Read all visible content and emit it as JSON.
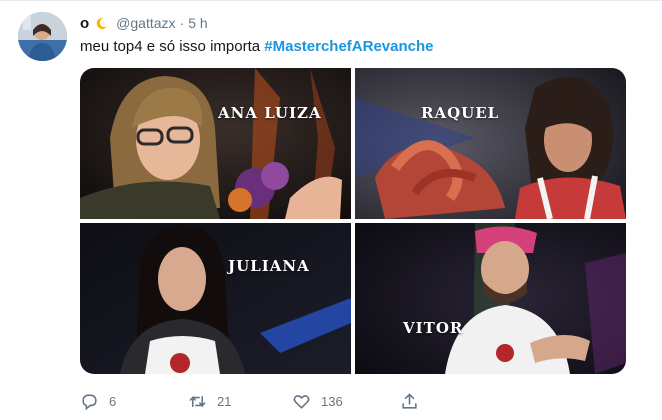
{
  "tweet": {
    "name": "o",
    "handle": "@gattazx",
    "separator": "·",
    "time": "5 h",
    "text_plain": "meu top4 e só isso importa ",
    "hashtag": "#MasterchefARevanche",
    "colors": {
      "hashtag": "#1b95e0",
      "secondary_text": "#657786",
      "primary_text": "#14171a"
    }
  },
  "media": {
    "panels": [
      {
        "label": "ANA LUIZA"
      },
      {
        "label": "RAQUEL"
      },
      {
        "label": "JULIANA"
      },
      {
        "label": "VITOR"
      }
    ]
  },
  "actions": {
    "reply": {
      "icon": "reply-icon",
      "count": "6"
    },
    "retweet": {
      "icon": "retweet-icon",
      "count": "21"
    },
    "like": {
      "icon": "heart-icon",
      "count": "136"
    },
    "share": {
      "icon": "share-icon"
    }
  }
}
